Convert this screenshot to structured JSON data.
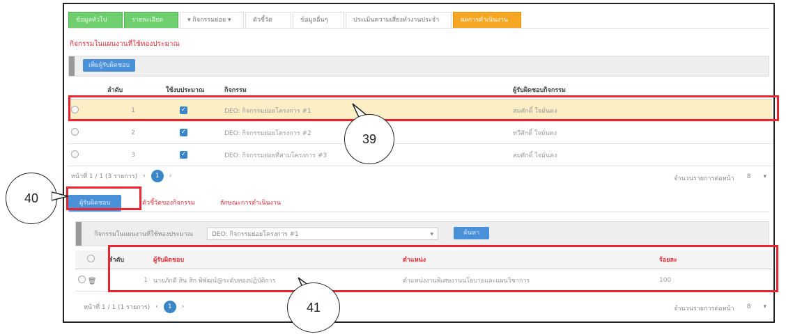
{
  "top_tabs": [
    {
      "label": "ข้อมูลทั่วไป",
      "style": "green"
    },
    {
      "label": "รายละเอียด",
      "style": "green"
    },
    {
      "label": "▾ กิจกรรมย่อย ▾",
      "style": "plain"
    },
    {
      "label": "ตัวชี้วัด",
      "style": "plain"
    },
    {
      "label": "ข้อมูลอื่นๆ",
      "style": "plain"
    },
    {
      "label": "ประเมินความเสี่ยงทำงานประจำ",
      "style": "plain"
    },
    {
      "label": "ผลการดำเนินงาน",
      "style": "orange"
    }
  ],
  "section_title": "กิจกรรมในแผนงานที่ใช้ทองประมาณ",
  "toolbar": {
    "add_button": "เพิ่มผู้รับผิดชอบ"
  },
  "table1": {
    "headers": [
      "ลำดับ",
      "ใช้งบประมาณ",
      "กิจกรรม",
      "ผู้รับผิดชอบกิจกรรม"
    ],
    "rows": [
      {
        "no": "1",
        "activity": "DEO: กิจกรรมย่อยโครงการ #1",
        "owner": "สมศักดิ์ ใจมั่นคง"
      },
      {
        "no": "2",
        "activity": "DEO: กิจกรรมย่อยโครงการ #2",
        "owner": "ทวีศักดิ์ ใจมั่นคง"
      },
      {
        "no": "3",
        "activity": "DEO: กิจกรรมย่อยที่สามโครงการ #3",
        "owner": "สมศักดิ์ ใจมั่นคง"
      }
    ]
  },
  "pager1": {
    "info": "หน้าที่ 1 / 1 (3 รายการ)",
    "prev": "‹",
    "page": "1",
    "next": "›",
    "right_info": "จำนวนรายการต่อหน้า",
    "size": "8",
    "arrow": "▾"
  },
  "sub_tabs": [
    "ผู้รับผิดชอบ",
    "ตัวชี้วัดของกิจกรรม",
    "ลักษณะการดำเนินงาน"
  ],
  "subtoolbar": {
    "label": "กิจกรรมในแผนงานที่ใช้ทองประมาณ",
    "select_value": "DEO: กิจกรรมย่อยโครงการ #1",
    "select_arrow": "▾",
    "button": "ค้นหา"
  },
  "table2": {
    "headers": [
      "ลำดับ",
      "ผู้รับผิดชอบ",
      "ตำแหน่ง",
      "ร้อยละ"
    ],
    "rows": [
      {
        "no": "1",
        "person": "นายภักดี สิน สิก พิพัฒน์@ระดับทองปฏิบัติการ",
        "position": "ตำแหน่งงานพิเศษงานนโยบายและแผนวิชาการ",
        "pct": "100"
      }
    ]
  },
  "pager2": {
    "info": "หน้าที่ 1 / 1 (1 รายการ)",
    "prev": "‹",
    "page": "1",
    "next": "›",
    "right_info": "จำนวนรายการต่อหน้า",
    "size": "8",
    "arrow": "▾"
  },
  "callouts": {
    "c39": "39",
    "c40": "40",
    "c41": "41"
  },
  "colors": {
    "highlight": "#e8242e",
    "accent_blue": "#3a86c8",
    "tab_orange": "#f5a623",
    "tab_green": "#6fcf6f",
    "selected_row": "#fcefc6"
  }
}
